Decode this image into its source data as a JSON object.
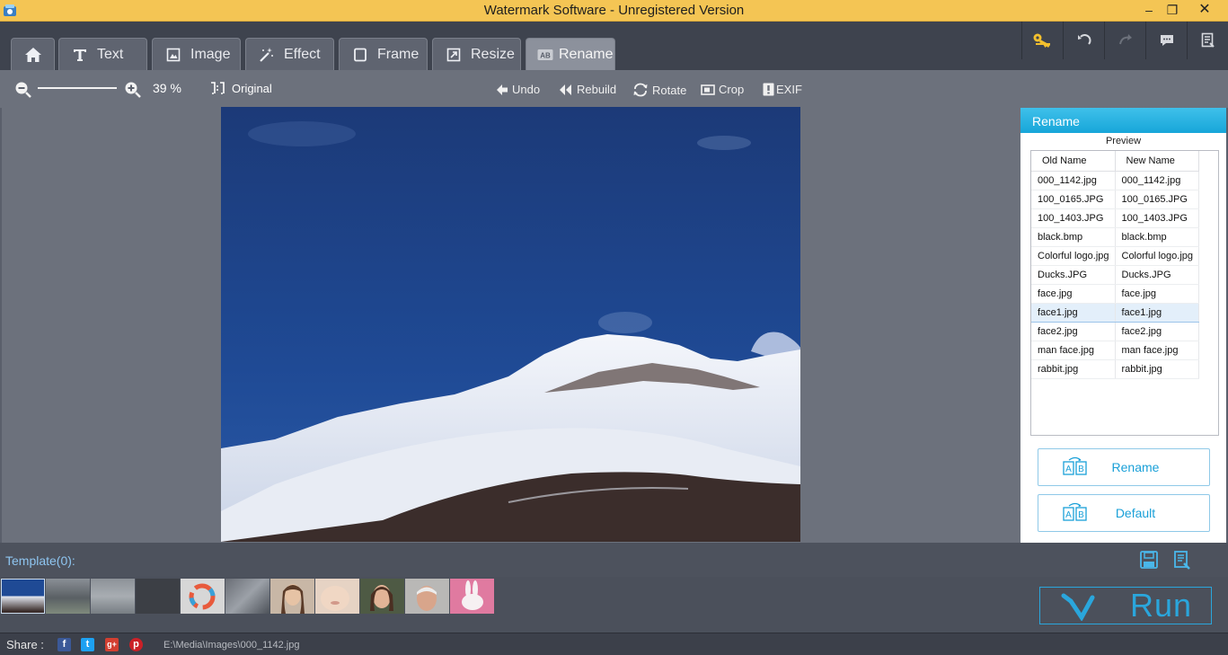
{
  "window": {
    "title": "Watermark Software - Unregistered Version",
    "controls": {
      "minimize": "–",
      "maximize": "❐",
      "close": "✕"
    }
  },
  "tabs": [
    {
      "id": "home",
      "label": "",
      "icon": "home-icon"
    },
    {
      "id": "text",
      "label": "Text",
      "icon": "text-icon"
    },
    {
      "id": "image",
      "label": "Image",
      "icon": "image-icon"
    },
    {
      "id": "effect",
      "label": "Effect",
      "icon": "magic-wand-icon"
    },
    {
      "id": "frame",
      "label": "Frame",
      "icon": "frame-icon"
    },
    {
      "id": "resize",
      "label": "Resize",
      "icon": "resize-icon"
    },
    {
      "id": "rename",
      "label": "Rename",
      "icon": "rename-icon",
      "active": true
    }
  ],
  "top_tools": [
    "key-icon",
    "undo-icon",
    "redo-icon",
    "comment-icon",
    "list-icon"
  ],
  "toolbar": {
    "zoom": "39 %",
    "original": "Original",
    "undo": "Undo",
    "rebuild": "Rebuild",
    "rotate": "Rotate",
    "crop": "Crop",
    "exif": "EXIF"
  },
  "panel": {
    "title": "Rename",
    "preview_label": "Preview",
    "columns": [
      "Old Name",
      "New Name"
    ],
    "rows": [
      [
        "000_1142.jpg",
        "000_1142.jpg"
      ],
      [
        "100_0165.JPG",
        "100_0165.JPG"
      ],
      [
        "100_1403.JPG",
        "100_1403.JPG"
      ],
      [
        "black.bmp",
        "black.bmp"
      ],
      [
        "Colorful logo.jpg",
        "Colorful logo.jpg"
      ],
      [
        "Ducks.JPG",
        "Ducks.JPG"
      ],
      [
        "face.jpg",
        "face.jpg"
      ],
      [
        "face1.jpg",
        "face1.jpg"
      ],
      [
        "face2.jpg",
        "face2.jpg"
      ],
      [
        "man face.jpg",
        "man face.jpg"
      ],
      [
        "rabbit.jpg",
        "rabbit.jpg"
      ]
    ],
    "selected_row": 7,
    "rename_button": "Rename",
    "default_button": "Default"
  },
  "template": {
    "label": "Template(0):"
  },
  "run_button": "Run",
  "status": {
    "share_label": "Share :",
    "path": "E:\\Media\\Images\\000_1142.jpg"
  },
  "colors": {
    "accent": "#1aa0d8",
    "title_bar": "#f4c554",
    "panel_head": "#17a6d9"
  }
}
